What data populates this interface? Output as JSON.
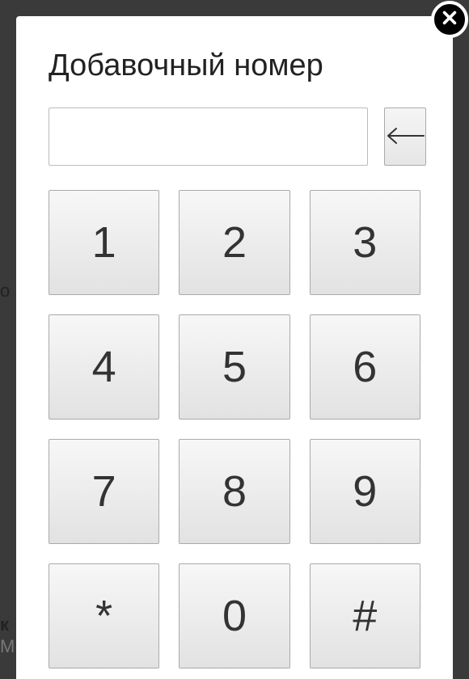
{
  "title": "Добавочный номер",
  "input": {
    "value": "",
    "placeholder": ""
  },
  "keys": [
    "1",
    "2",
    "3",
    "4",
    "5",
    "6",
    "7",
    "8",
    "9",
    "*",
    "0",
    "#"
  ],
  "bg": {
    "frag1": "о",
    "frag2": "к",
    "frag3": "М"
  }
}
